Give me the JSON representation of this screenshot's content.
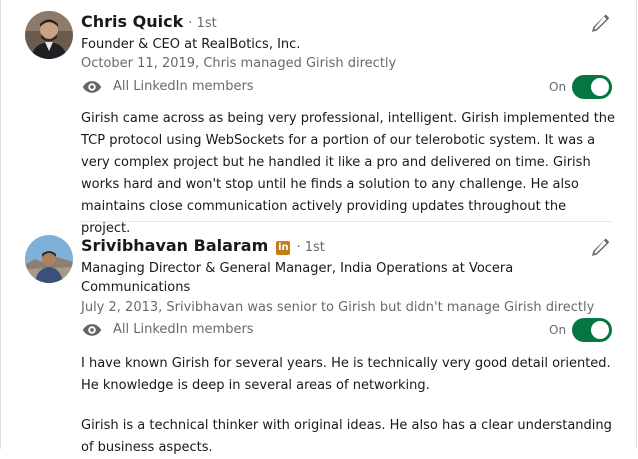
{
  "recommendations": [
    {
      "name": "Chris Quick",
      "degree": "· 1st",
      "headline": "Founder & CEO at RealBotics, Inc.",
      "relationship": "October 11, 2019, Chris managed Girish directly",
      "visibility": "All LinkedIn members",
      "toggle_label": "On",
      "text": "Girish came across as being very professional, intelligent. Girish implemented the TCP protocol using WebSockets for a portion of our telerobotic system. It was a very complex project but he handled it like a pro and delivered on time. Girish works hard and won't stop until he finds a solution to any challenge. He also maintains close communication actively providing updates throughout the project."
    },
    {
      "name": "Srivibhavan Balaram",
      "badge": "in",
      "degree": "· 1st",
      "headline": "Managing Director & General Manager, India Operations at Vocera Communications",
      "relationship": "July 2, 2013, Srivibhavan was senior to Girish but didn't manage Girish directly",
      "visibility": "All LinkedIn members",
      "toggle_label": "On",
      "text_p1": "I have known Girish for several years. He is technically very good detail oriented. He knowledge is deep in several areas of networking.",
      "text_p2": "Girish is a technical thinker with original ideas. He also has a clear understanding of business aspects."
    }
  ],
  "colors": {
    "toggle_on": "#057642",
    "premium_badge": "#c37d16"
  },
  "icons": [
    "pencil-icon",
    "eye-icon"
  ]
}
